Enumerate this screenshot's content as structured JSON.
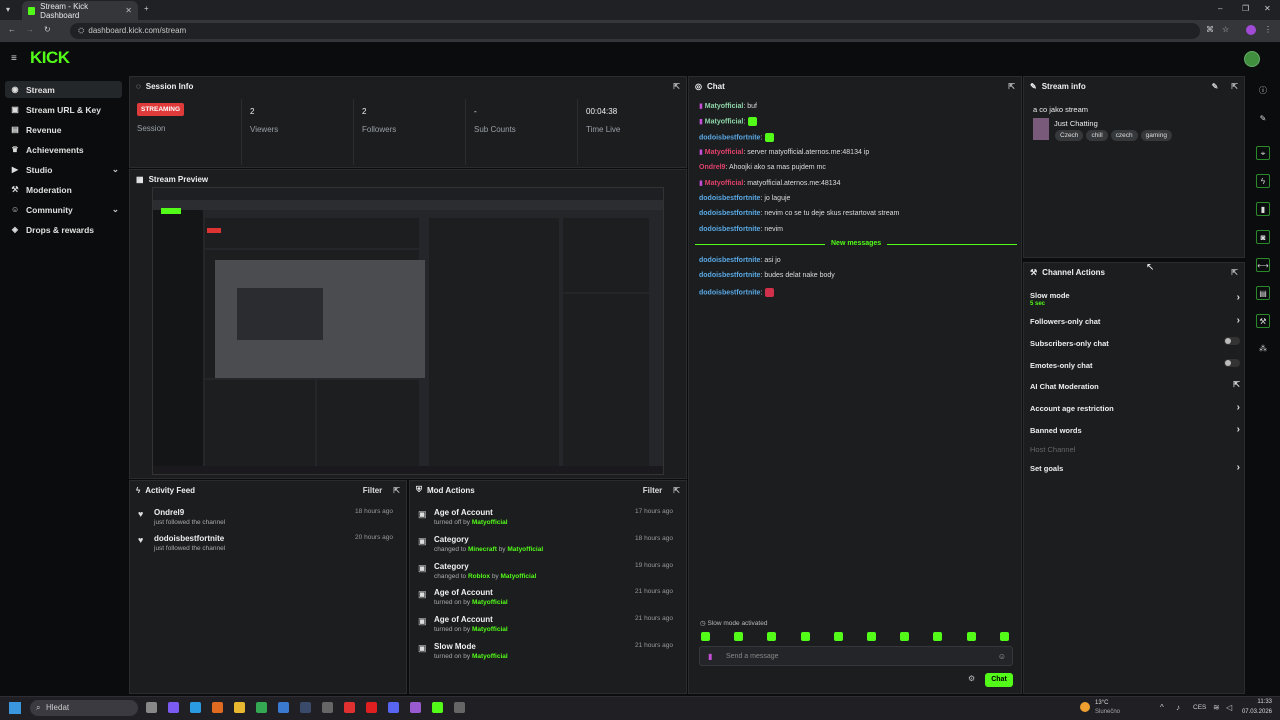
{
  "browser": {
    "tab_title": "Stream - Kick Dashboard",
    "url": "dashboard.kick.com/stream"
  },
  "brand": {
    "logo": "KICK",
    "accent": "#53fc18"
  },
  "sidebar": {
    "items": [
      {
        "label": "Stream",
        "icon": "broadcast-icon"
      },
      {
        "label": "Stream URL & Key",
        "icon": "key-icon"
      },
      {
        "label": "Revenue",
        "icon": "money-icon"
      },
      {
        "label": "Achievements",
        "icon": "trophy-icon"
      },
      {
        "label": "Studio",
        "icon": "video-icon"
      },
      {
        "label": "Moderation",
        "icon": "hammer-icon"
      },
      {
        "label": "Community",
        "icon": "users-icon"
      },
      {
        "label": "Drops & rewards",
        "icon": "gift-icon"
      }
    ]
  },
  "session": {
    "title": "Session Info",
    "status_badge": "STREAMING",
    "session_label": "Session",
    "stats": [
      {
        "value": "2",
        "label": "Viewers"
      },
      {
        "value": "2",
        "label": "Followers"
      },
      {
        "value": "-",
        "label": "Sub Counts"
      },
      {
        "value": "00:04:38",
        "label": "Time Live"
      }
    ]
  },
  "preview": {
    "title": "Stream Preview"
  },
  "activity": {
    "title": "Activity Feed",
    "filter": "Filter",
    "items": [
      {
        "name": "Ondrel9",
        "sub": "just followed the channel",
        "time": "18 hours ago"
      },
      {
        "name": "dodoisbestfortnite",
        "sub": "just followed the channel",
        "time": "20 hours ago"
      }
    ]
  },
  "mod": {
    "title": "Mod Actions",
    "filter": "Filter",
    "items": [
      {
        "name": "Age of Account",
        "pre": "turned off by",
        "mid": "",
        "by": "Matyofficial",
        "time": "17 hours ago"
      },
      {
        "name": "Category",
        "pre": "changed to",
        "mid": "Minecraft",
        "by": "Matyofficial",
        "time": "18 hours ago"
      },
      {
        "name": "Category",
        "pre": "changed to",
        "mid": "Roblox",
        "by": "Matyofficial",
        "time": "19 hours ago"
      },
      {
        "name": "Age of Account",
        "pre": "turned on by",
        "mid": "",
        "by": "Matyofficial",
        "time": "21 hours ago"
      },
      {
        "name": "Age of Account",
        "pre": "turned on by",
        "mid": "",
        "by": "Matyofficial",
        "time": "21 hours ago"
      },
      {
        "name": "Slow Mode",
        "pre": "turned on by",
        "mid": "",
        "by": "Matyofficial",
        "time": "21 hours ago"
      }
    ]
  },
  "chat": {
    "title": "Chat",
    "new_messages": "New messages",
    "slow_mode": "Slow mode activated",
    "placeholder": "Send a message",
    "send": "Chat",
    "messages": [
      {
        "user": "Matyofficial",
        "text": ": buf",
        "color": "#8fd6a8",
        "mic": true
      },
      {
        "user": "Matyofficial",
        "text": ":",
        "color": "#8fd6a8",
        "mic": true,
        "emote": true
      },
      {
        "user": "dodoisbestfortnite",
        "text": ":",
        "color": "#5aa9e6",
        "emote": true
      },
      {
        "user": "Matyofficial",
        "text": ": server matyofficial.aternos.me:48134 ip",
        "color": "#e0426b",
        "mic": true
      },
      {
        "user": "Ondrel9",
        "text": ": Ahoojki ako sa mas pujdem mc",
        "color": "#e0426b"
      },
      {
        "user": "Matyofficial",
        "text": ": matyofficial.aternos.me:48134",
        "color": "#e0426b",
        "mic": true
      },
      {
        "user": "dodoisbestfortnite",
        "text": ": jo laguje",
        "color": "#5aa9e6"
      },
      {
        "user": "dodoisbestfortnite",
        "text": ": nevim co se tu deje skus restartovat stream",
        "color": "#5aa9e6"
      },
      {
        "user": "dodoisbestfortnite",
        "text": ": nevim",
        "color": "#5aa9e6"
      },
      {
        "user": "dodoisbestfortnite",
        "text": ": asi jo",
        "color": "#5aa9e6"
      },
      {
        "user": "dodoisbestfortnite",
        "text": ": budes delat nake body",
        "color": "#5aa9e6"
      },
      {
        "user": "dodoisbestfortnite",
        "text": ":",
        "color": "#5aa9e6",
        "emote": true
      }
    ]
  },
  "stream_info": {
    "title": "Stream info",
    "stream_title": "a co jako stream",
    "category": "Just Chatting",
    "tags": [
      "Czech",
      "chill",
      "czech",
      "gaming"
    ]
  },
  "channel_actions": {
    "title": "Channel Actions",
    "slow_mode_value": "5 sec",
    "items": [
      {
        "label": "Slow mode",
        "kind": "arrow"
      },
      {
        "label": "Followers-only chat",
        "kind": "arrow"
      },
      {
        "label": "Subscribers-only chat",
        "kind": "toggle"
      },
      {
        "label": "Emotes-only chat",
        "kind": "toggle"
      },
      {
        "label": "AI Chat Moderation",
        "kind": "pop"
      },
      {
        "label": "Account age restriction",
        "kind": "arrow"
      },
      {
        "label": "Banned words",
        "kind": "arrow"
      },
      {
        "label": "Host Channel",
        "kind": "disabled"
      },
      {
        "label": "Set goals",
        "kind": "arrow"
      }
    ]
  },
  "taskbar": {
    "search": "Hledat",
    "weather_temp": "13°C",
    "weather_text": "Slunečno",
    "lang": "CES",
    "time": "11:33",
    "date": "07.03.2026"
  }
}
